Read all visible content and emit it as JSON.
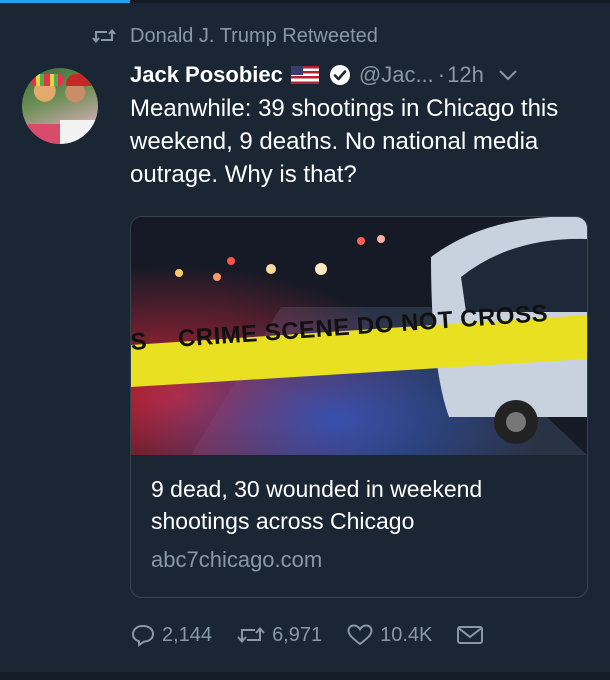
{
  "retweet_banner": {
    "icon": "retweet-icon",
    "text": "Donald J. Trump Retweeted"
  },
  "tweet": {
    "author_name": "Jack Posobiec",
    "author_flag_icon": "us-flag-icon",
    "verified_icon": "verified-badge-icon",
    "handle": "@Jac...",
    "separator": "·",
    "time": "12h",
    "menu_icon": "chevron-down-icon",
    "text": "Meanwhile: 39 shootings in Chicago this weekend, 9 deaths. No national media outrage. Why is that?"
  },
  "card": {
    "image_tape_text": "CRIME SCENE DO NOT CROSS",
    "image_tape_prefix": "S",
    "title": "9 dead, 30 wounded in weekend shootings across Chicago",
    "domain": "abc7chicago.com"
  },
  "actions": {
    "reply_count": "2,144",
    "retweet_count": "6,971",
    "like_count": "10.4K"
  },
  "colors": {
    "background": "#1b2634",
    "muted_text": "#8899a6",
    "accent": "#1da1f2",
    "tape_yellow": "#e8e021"
  }
}
